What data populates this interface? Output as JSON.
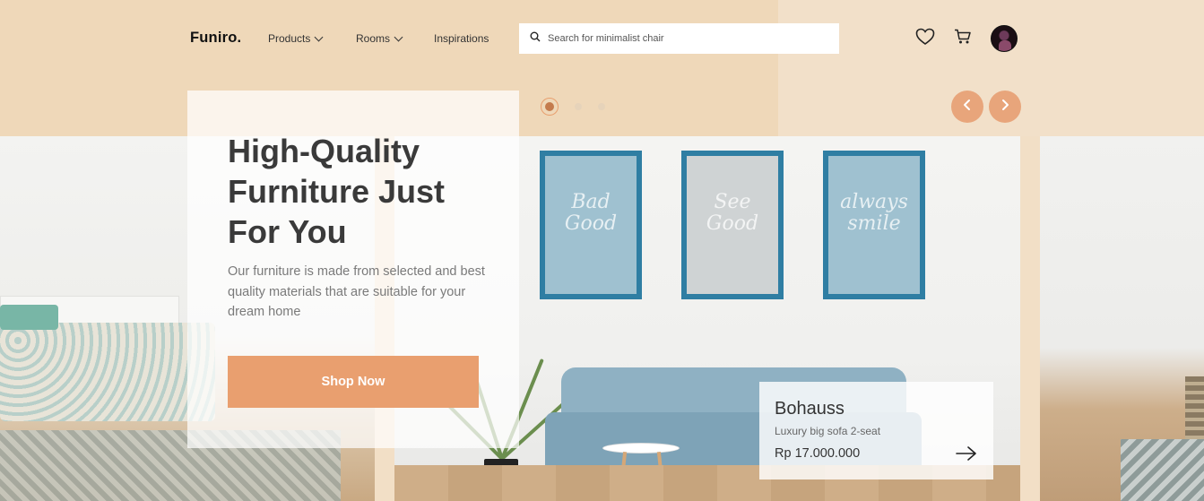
{
  "brand": {
    "logo": "Funiro."
  },
  "nav": {
    "items": [
      {
        "label": "Products",
        "has_dropdown": true
      },
      {
        "label": "Rooms",
        "has_dropdown": true
      },
      {
        "label": "Inspirations",
        "has_dropdown": false
      }
    ]
  },
  "search": {
    "placeholder": "Search for minimalist chair",
    "value": ""
  },
  "header_icons": [
    "heart-icon",
    "cart-icon",
    "avatar"
  ],
  "hero": {
    "title": "High-Quality Furniture Just For You",
    "description": "Our furniture is made from selected and best quality materials that are suitable for your dream home",
    "cta_label": "Shop Now"
  },
  "slider": {
    "total_slides": 3,
    "active_index": 0
  },
  "product_card": {
    "name": "Bohauss",
    "subtitle": "Luxury big sofa 2-seat",
    "price": "Rp 17.000.000"
  },
  "frames": [
    {
      "text": "Bad Good"
    },
    {
      "text": "See Good"
    },
    {
      "text": "always smile"
    }
  ],
  "colors": {
    "accent": "#e99f6f",
    "accent_dark": "#c47b4d",
    "bg_beige": "#efd8b9",
    "frame_blue": "#2f7ea3",
    "text_dark": "#3a3a3a"
  }
}
